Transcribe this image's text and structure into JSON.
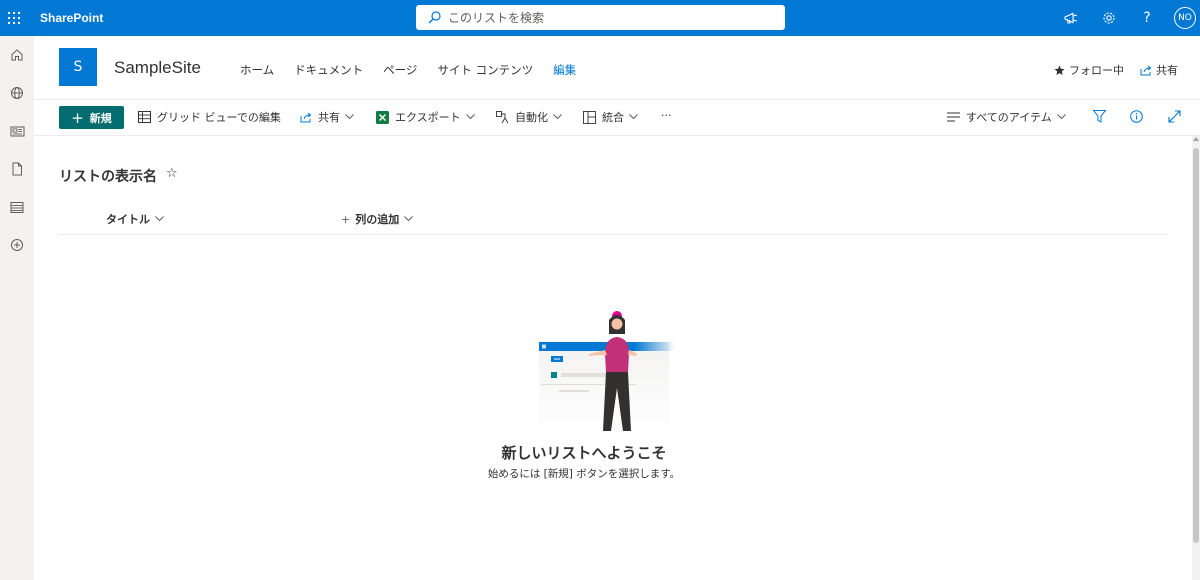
{
  "suite": {
    "brand": "SharePoint",
    "search_placeholder": "このリストを検索",
    "avatar": "NO",
    "help": "?"
  },
  "site": {
    "logo_letter": "S",
    "title": "SampleSite",
    "nav": [
      "ホーム",
      "ドキュメント",
      "ページ",
      "サイト コンテンツ",
      "編集"
    ],
    "follow": "フォロー中",
    "share": "共有"
  },
  "commands": {
    "new": "新規",
    "grid_edit": "グリッド ビューでの編集",
    "share": "共有",
    "export": "エクスポート",
    "automate": "自動化",
    "integrate": "統合",
    "more": "···",
    "view": "すべてのアイテム"
  },
  "list": {
    "title": "リストの表示名",
    "star": "☆",
    "columns": [
      "タイトル",
      "列の追加"
    ],
    "add_prefix": "+"
  },
  "empty_state": {
    "title": "新しいリストへようこそ",
    "subtitle": "始めるには [新規] ボタンを選択します。"
  },
  "colors": {
    "suite_blue": "#0078d4",
    "new_button": "#036c70",
    "nav_active": "#0078d4"
  }
}
